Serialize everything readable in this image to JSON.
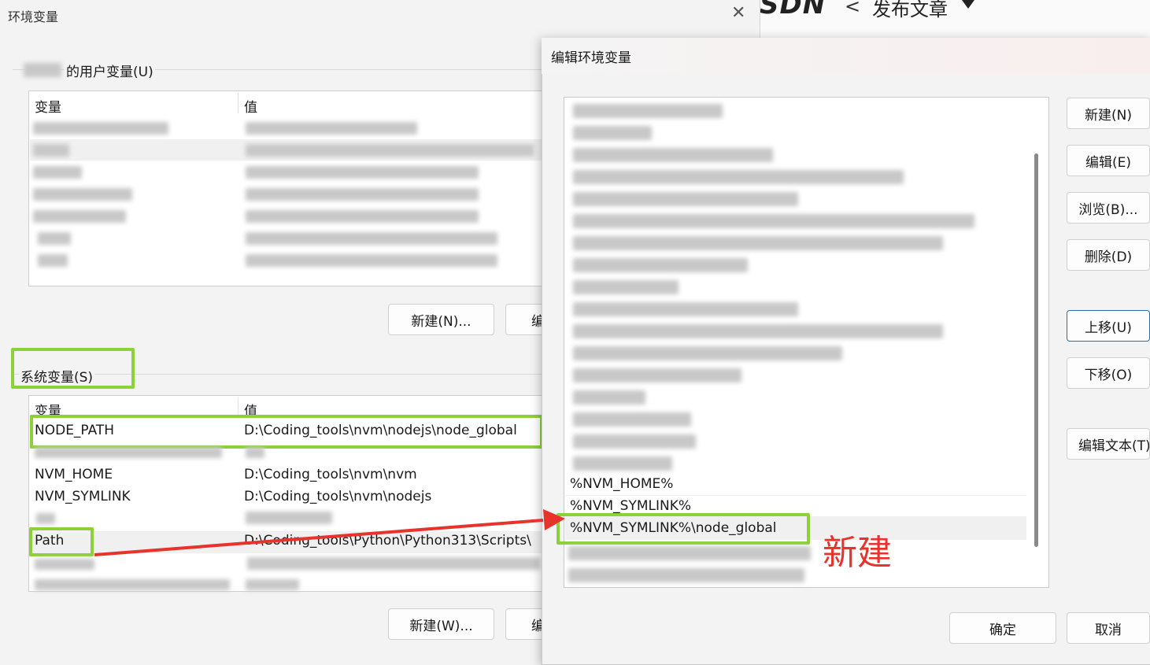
{
  "background": {
    "logo": "SDN",
    "back": "<",
    "title": "发布文章"
  },
  "env_dialog": {
    "title": "环境变量",
    "close": "✕",
    "user_group_label": "的用户变量(U)",
    "user_table": {
      "headers": [
        "变量",
        "值"
      ],
      "new_button": "新建(N)...",
      "edit_button": "编"
    },
    "system_group_label": "系统变量(S)",
    "system_table": {
      "headers": [
        "变量",
        "值"
      ],
      "rows": [
        {
          "name": "NODE_PATH",
          "value": "D:\\Coding_tools\\nvm\\nodejs\\node_global"
        },
        {
          "name": "NVM_HOME",
          "value": "D:\\Coding_tools\\nvm\\nvm"
        },
        {
          "name": "NVM_SYMLINK",
          "value": "D:\\Coding_tools\\nvm\\nodejs"
        },
        {
          "name": "Path",
          "value": "D:\\Coding_tools\\Python\\Python313\\Scripts\\"
        }
      ],
      "new_button": "新建(W)...",
      "edit_button": "编"
    }
  },
  "edit_dialog": {
    "title": "编辑环境变量",
    "items": [
      "%NVM_HOME%",
      "%NVM_SYMLINK%",
      "%NVM_SYMLINK%\\node_global"
    ],
    "buttons": [
      "新建(N)",
      "编辑(E)",
      "浏览(B)...",
      "删除(D)",
      "上移(U)",
      "下移(O)",
      "编辑文本(T)"
    ],
    "ok": "确定",
    "cancel": "取消"
  },
  "annotation": {
    "label": "新建",
    "color": "#e8322c",
    "highlight_color": "#8dd13a"
  }
}
